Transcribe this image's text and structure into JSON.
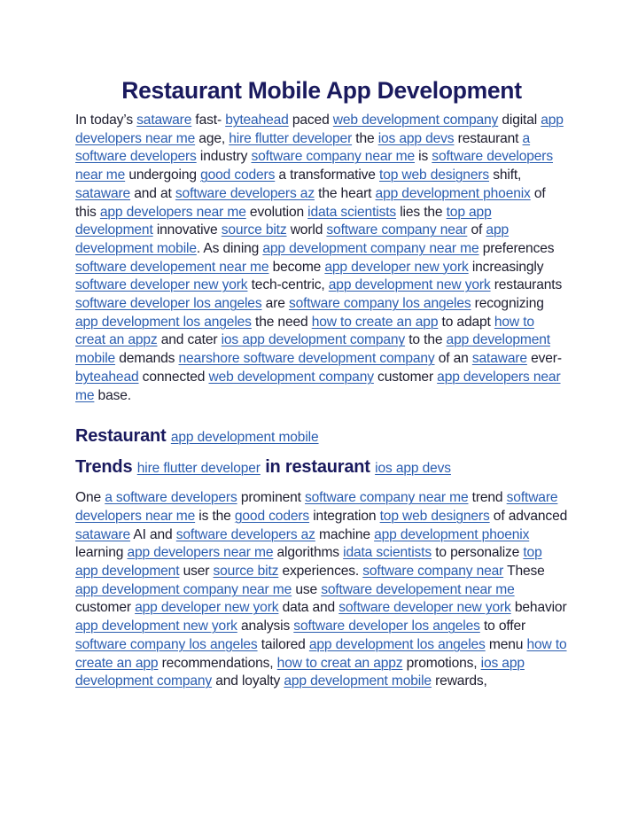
{
  "title": "Restaurant Mobile App Development",
  "paragraph1": [
    {
      "t": "In today’s "
    },
    {
      "l": "sataware"
    },
    {
      "t": " fast- "
    },
    {
      "l": "byteahead"
    },
    {
      "t": " paced "
    },
    {
      "l": "web development company"
    },
    {
      "t": " digital "
    },
    {
      "l": "app developers near me"
    },
    {
      "t": " age, "
    },
    {
      "l": "hire flutter developer"
    },
    {
      "t": " the "
    },
    {
      "l": "ios app devs"
    },
    {
      "t": " restaurant "
    },
    {
      "l": "a software developers"
    },
    {
      "t": " industry "
    },
    {
      "l": "software company near me"
    },
    {
      "t": " is "
    },
    {
      "l": "software developers near me"
    },
    {
      "t": " undergoing "
    },
    {
      "l": "good coders"
    },
    {
      "t": " a transformative "
    },
    {
      "l": "top web designers"
    },
    {
      "t": " shift, "
    },
    {
      "l": "sataware"
    },
    {
      "t": " and at "
    },
    {
      "l": "software developers az"
    },
    {
      "t": " the heart "
    },
    {
      "l": "app development phoenix"
    },
    {
      "t": " of this "
    },
    {
      "l": "app developers near me"
    },
    {
      "t": " evolution "
    },
    {
      "l": "idata scientists"
    },
    {
      "t": " lies the "
    },
    {
      "l": "top app development"
    },
    {
      "t": " innovative "
    },
    {
      "l": "source bitz"
    },
    {
      "t": " world "
    },
    {
      "l": "software company near"
    },
    {
      "t": " of "
    },
    {
      "l": "app development mobile"
    },
    {
      "t": ". As dining "
    },
    {
      "l": "app development company near me"
    },
    {
      "t": " preferences "
    },
    {
      "l": "software developement near me"
    },
    {
      "t": " become "
    },
    {
      "l": "app developer new york"
    },
    {
      "t": " increasingly "
    },
    {
      "l": "software developer new york"
    },
    {
      "t": " tech-centric, "
    },
    {
      "l": "app development new york"
    },
    {
      "t": " restaurants "
    },
    {
      "l": "software developer los angeles"
    },
    {
      "t": " are "
    },
    {
      "l": "software company los angeles"
    },
    {
      "t": " recognizing "
    },
    {
      "l": "app development los angeles"
    },
    {
      "t": " the need "
    },
    {
      "l": "how to create an app"
    },
    {
      "t": " to adapt "
    },
    {
      "l": "how to creat an appz"
    },
    {
      "t": " and cater "
    },
    {
      "l": "ios app development company"
    },
    {
      "t": " to the "
    },
    {
      "l": "app development mobile"
    },
    {
      "t": " demands "
    },
    {
      "l": "nearshore software development company"
    },
    {
      "t": " of an "
    },
    {
      "l": "sataware"
    },
    {
      "t": " ever- "
    },
    {
      "l": "byteahead"
    },
    {
      "t": " connected "
    },
    {
      "l": "web development company"
    },
    {
      "t": " customer "
    },
    {
      "l": "app developers near me"
    },
    {
      "t": " base."
    }
  ],
  "heading2": [
    {
      "t": "Restaurant "
    },
    {
      "l": "app development mobile"
    }
  ],
  "heading3": [
    {
      "t": "Trends "
    },
    {
      "l": "hire flutter developer"
    },
    {
      "t": " in restaurant "
    },
    {
      "l": "ios app devs"
    }
  ],
  "paragraph2": [
    {
      "t": "One "
    },
    {
      "l": "a software developers"
    },
    {
      "t": " prominent "
    },
    {
      "l": "software company near me"
    },
    {
      "t": " trend "
    },
    {
      "l": "software developers near me"
    },
    {
      "t": " is the "
    },
    {
      "l": "good coders"
    },
    {
      "t": " integration "
    },
    {
      "l": "top web designers"
    },
    {
      "t": " of advanced "
    },
    {
      "l": "sataware"
    },
    {
      "t": " AI and "
    },
    {
      "l": "software developers az"
    },
    {
      "t": " machine "
    },
    {
      "l": "app development phoenix"
    },
    {
      "t": " learning "
    },
    {
      "l": "app developers near me"
    },
    {
      "t": " algorithms "
    },
    {
      "l": "idata scientists"
    },
    {
      "t": " to personalize "
    },
    {
      "l": "top app development"
    },
    {
      "t": " user "
    },
    {
      "l": "source bitz"
    },
    {
      "t": " experiences. "
    },
    {
      "l": "software company near"
    },
    {
      "t": " These "
    },
    {
      "l": "app development company near me"
    },
    {
      "t": " use "
    },
    {
      "l": "software developement near me"
    },
    {
      "t": " customer "
    },
    {
      "l": "app developer new york"
    },
    {
      "t": " data and "
    },
    {
      "l": "software developer new york"
    },
    {
      "t": " behavior "
    },
    {
      "l": "app development new york"
    },
    {
      "t": " analysis "
    },
    {
      "l": "software developer los angeles"
    },
    {
      "t": " to offer "
    },
    {
      "l": "software company los angeles"
    },
    {
      "t": " tailored "
    },
    {
      "l": "app development los angeles"
    },
    {
      "t": " menu "
    },
    {
      "l": "how to create an app"
    },
    {
      "t": " recommendations, "
    },
    {
      "l": "how to creat an appz"
    },
    {
      "t": " promotions, "
    },
    {
      "l": "ios app development company"
    },
    {
      "t": " and loyalty "
    },
    {
      "l": "app development mobile"
    },
    {
      "t": " rewards,"
    }
  ],
  "colors": {
    "heading": "#1a1a5e",
    "link": "#2a5db0",
    "text": "#1c1c2e"
  }
}
